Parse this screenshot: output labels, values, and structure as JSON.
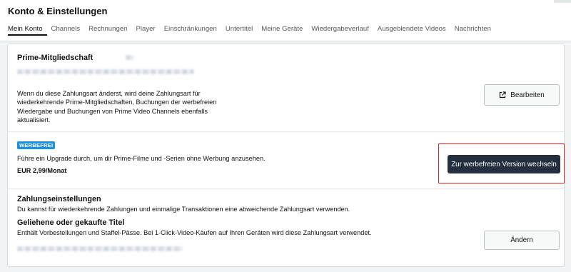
{
  "header": {
    "title": "Konto & Einstellungen",
    "tabs": [
      {
        "label": "Mein Konto",
        "active": true
      },
      {
        "label": "Channels"
      },
      {
        "label": "Rechnungen"
      },
      {
        "label": "Player"
      },
      {
        "label": "Einschränkungen"
      },
      {
        "label": "Untertitel"
      },
      {
        "label": "Meine Geräte"
      },
      {
        "label": "Wiedergabeverlauf"
      },
      {
        "label": "Ausgeblendete Videos"
      },
      {
        "label": "Nachrichten"
      }
    ]
  },
  "prime": {
    "title": "Prime-Mitgliedschaft",
    "description_lines": [
      "Wenn du diese Zahlungsart änderst, wird deine Zahlungsart für",
      "wiederkehrende Prime-Mitgliedschaften, Buchungen der werbefreien",
      "Wiedergabe und Buchungen von Prime Video Channels ebenfalls",
      "aktualisiert."
    ],
    "edit_button": "Bearbeiten",
    "edit_icon": "external-link-icon"
  },
  "adfree": {
    "badge": "WERBEFREI",
    "description": "Führe ein Upgrade durch, um dir Prime-Filme und -Serien ohne Werbung anzusehen.",
    "price": "EUR 2,99/Monat",
    "switch_button": "Zur werbefreien Version wechseln",
    "badge_color": "#1d8fe0",
    "highlight_color": "#e01e1e"
  },
  "payment": {
    "title": "Zahlungseinstellungen",
    "description": "Du kannst für wiederkehrende Zahlungen und einmalige Transaktionen eine abweichende Zahlungsart verwenden.",
    "rented_title": "Geliehene oder gekaufte Titel",
    "rented_description": "Enthält Vorbestellungen und Staffel-Pässe. Bei 1-Click-Video-Käufen auf Ihren Geräten wird diese Zahlungsart verwendet.",
    "change_button": "Ändern"
  },
  "colors": {
    "dark_button": "#232f3e",
    "background": "#f2f3f4"
  }
}
